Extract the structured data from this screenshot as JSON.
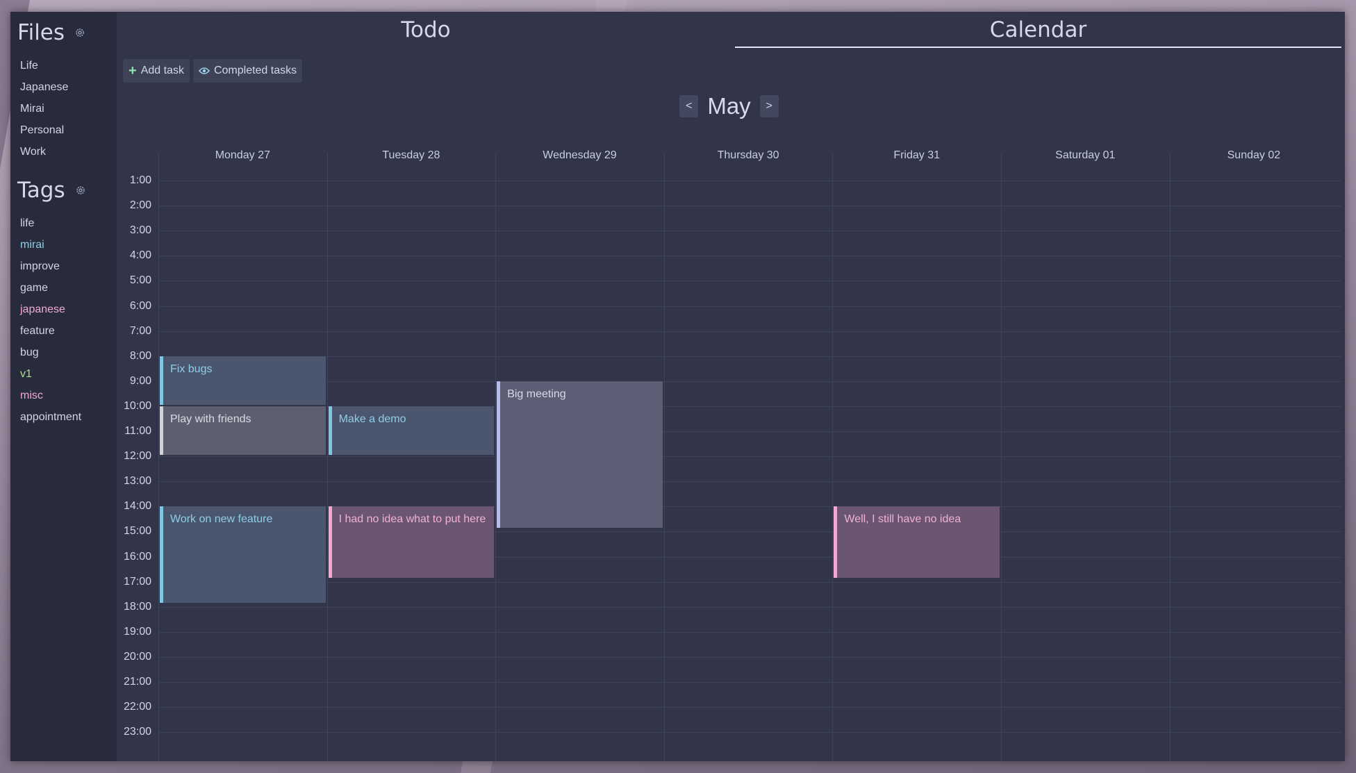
{
  "sidebar": {
    "files_title": "Files",
    "files": [
      "Life",
      "Japanese",
      "Mirai",
      "Personal",
      "Work"
    ],
    "tags_title": "Tags",
    "tags": [
      {
        "label": "life",
        "color": "#d2d5e4"
      },
      {
        "label": "mirai",
        "color": "#8fcde6"
      },
      {
        "label": "improve",
        "color": "#d2d5e4"
      },
      {
        "label": "game",
        "color": "#d2d5e4"
      },
      {
        "label": "japanese",
        "color": "#f2a9d4"
      },
      {
        "label": "feature",
        "color": "#d2d5e4"
      },
      {
        "label": "bug",
        "color": "#d2d5e4"
      },
      {
        "label": "v1",
        "color": "#a6e28c"
      },
      {
        "label": "misc",
        "color": "#f2a9d4"
      },
      {
        "label": "appointment",
        "color": "#d2d5e4"
      }
    ]
  },
  "tabs": {
    "todo": "Todo",
    "calendar": "Calendar",
    "active": "calendar"
  },
  "toolbar": {
    "add_task": "Add task",
    "completed_tasks": "Completed tasks"
  },
  "month_nav": {
    "prev": "<",
    "month": "May",
    "next": ">"
  },
  "calendar": {
    "days": [
      "Monday 27",
      "Tuesday 28",
      "Wednesday 29",
      "Thursday 30",
      "Friday 31",
      "Saturday 01",
      "Sunday 02"
    ],
    "hours": [
      "1:00",
      "2:00",
      "3:00",
      "4:00",
      "5:00",
      "6:00",
      "7:00",
      "8:00",
      "9:00",
      "10:00",
      "11:00",
      "12:00",
      "13:00",
      "14:00",
      "15:00",
      "16:00",
      "17:00",
      "18:00",
      "19:00",
      "20:00",
      "21:00",
      "22:00",
      "23:00"
    ],
    "events": [
      {
        "title": "Fix bugs",
        "day": 0,
        "start": 8,
        "end": 10,
        "style": "blue"
      },
      {
        "title": "Play with friends",
        "day": 0,
        "start": 10,
        "end": 12,
        "style": "grey"
      },
      {
        "title": "Make a demo",
        "day": 1,
        "start": 10,
        "end": 12,
        "style": "blue"
      },
      {
        "title": "Big meeting",
        "day": 2,
        "start": 9,
        "end": 14.9,
        "style": "lav"
      },
      {
        "title": "Work on new feature",
        "day": 0,
        "start": 14,
        "end": 17.9,
        "style": "blue"
      },
      {
        "title": "I had no idea what to put here",
        "day": 1,
        "start": 14,
        "end": 16.9,
        "style": "pink"
      },
      {
        "title": "Well, I still have no idea",
        "day": 4,
        "start": 14,
        "end": 16.9,
        "style": "pink"
      }
    ]
  }
}
